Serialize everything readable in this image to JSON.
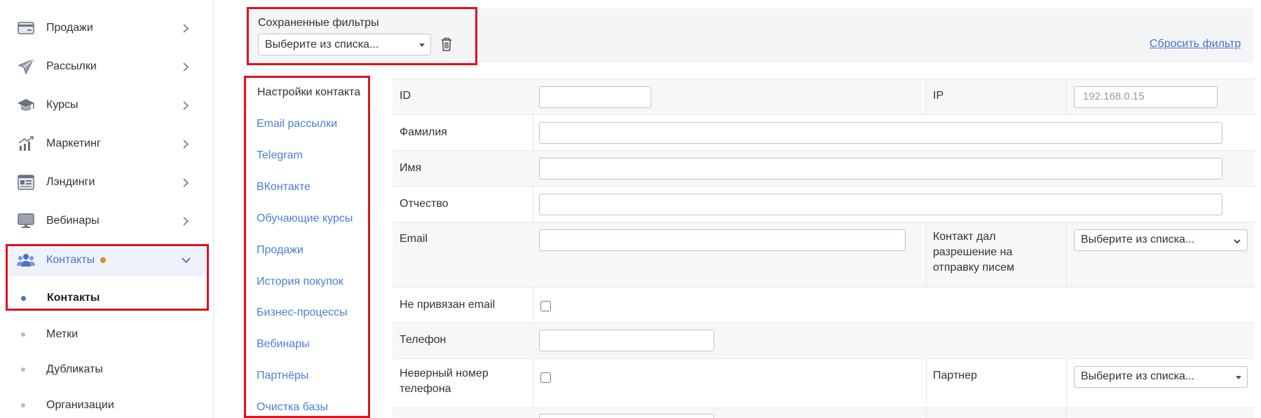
{
  "sidebar": {
    "items": [
      {
        "label": "Продажи",
        "icon": "card-icon"
      },
      {
        "label": "Рассылки",
        "icon": "paper-plane-icon"
      },
      {
        "label": "Курсы",
        "icon": "graduation-cap-icon"
      },
      {
        "label": "Маркетинг",
        "icon": "chart-growth-icon"
      },
      {
        "label": "Лэндинги",
        "icon": "landing-page-icon"
      },
      {
        "label": "Вебинары",
        "icon": "monitor-icon"
      },
      {
        "label": "Контакты",
        "icon": "users-icon"
      }
    ],
    "subitems": [
      {
        "label": "Контакты"
      },
      {
        "label": "Метки"
      },
      {
        "label": "Дубликаты"
      },
      {
        "label": "Организации"
      }
    ]
  },
  "filters": {
    "saved_label": "Сохраненные фильтры",
    "select_value": "Выберите из списка...",
    "reset_label": "Сбросить фильтр"
  },
  "settings_nav": {
    "heading": "Настройки контакта",
    "links": [
      "Email рассылки",
      "Telegram",
      "ВКонтакте",
      "Обучающие курсы",
      "Продажи",
      "История покупок",
      "Бизнес-процессы",
      "Вебинары",
      "Партнёры",
      "Очистка базы"
    ]
  },
  "form": {
    "id_label": "ID",
    "ip_label": "IP",
    "ip_placeholder": "192.168.0.15",
    "lastname_label": "Фамилия",
    "firstname_label": "Имя",
    "middlename_label": "Отчество",
    "email_label": "Email",
    "consent_label": "Контакт дал разрешение на отправку писем",
    "consent_value": "Выберите из списка...",
    "no_email_label": "Не привязан email",
    "phone_label": "Телефон",
    "bad_phone_label": "Неверный номер телефона",
    "partner_label": "Партнер",
    "partner_value": "Выберите из списка..."
  },
  "colors": {
    "accent": "#4a6fd0",
    "link": "#4a7fd8",
    "highlight": "#e0111a",
    "badge": "#d88a2c"
  }
}
